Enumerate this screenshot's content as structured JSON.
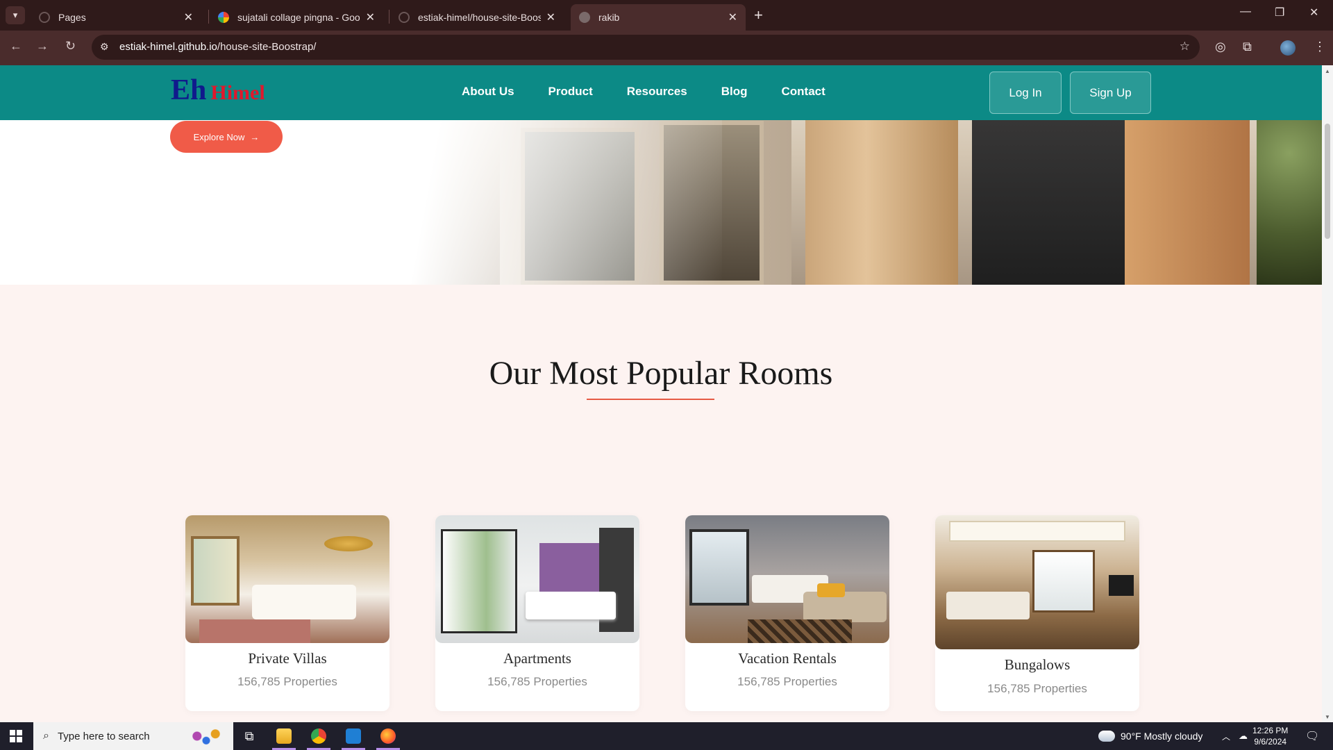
{
  "browser": {
    "tabs": [
      {
        "title": "Pages",
        "icon": "github-icon"
      },
      {
        "title": "sujatali collage pingna - Google",
        "icon": "google-icon"
      },
      {
        "title": "estiak-himel/house-site-Boostra",
        "icon": "github-icon"
      },
      {
        "title": "rakib",
        "icon": "globe-icon",
        "active": true
      }
    ],
    "url_host": "estiak-himel.github.io",
    "url_path": "/house-site-Boostrap/"
  },
  "site": {
    "logo_eh": "Eh",
    "logo_himel": "Himel",
    "nav": [
      "About Us",
      "Product",
      "Resources",
      "Blog",
      "Contact"
    ],
    "login_label": "Log In",
    "signup_label": "Sign Up",
    "explore_label": "Explore Now",
    "section_title": "Our Most Popular Rooms",
    "rooms": [
      {
        "name": "Private Villas",
        "count": "156,785 Properties"
      },
      {
        "name": "Apartments",
        "count": "156,785 Properties"
      },
      {
        "name": "Vacation Rentals",
        "count": "156,785 Properties"
      },
      {
        "name": "Bungalows",
        "count": "156,785 Properties"
      }
    ]
  },
  "taskbar": {
    "search_placeholder": "Type here to search",
    "weather": "90°F  Mostly cloudy",
    "time": "12:26 PM",
    "date": "9/6/2024"
  },
  "colors": {
    "nav_bg": "#0c8a86",
    "accent": "#f05b48",
    "section_bg": "#fdf3f1"
  }
}
